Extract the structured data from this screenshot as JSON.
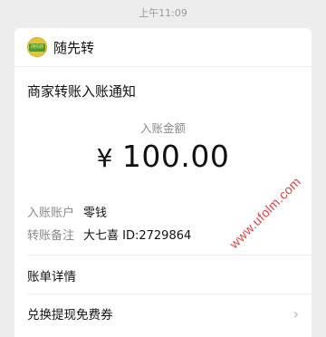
{
  "status_bar": {
    "time": "上午11:09"
  },
  "app": {
    "name": "随先转",
    "logo_icon": "suixianzhuan-logo-icon"
  },
  "notice": {
    "title": "商家转账入账通知",
    "amount_label": "入账金额",
    "currency": "¥",
    "amount": "100.00"
  },
  "details": [
    {
      "label": "入账账户",
      "value": "零钱"
    },
    {
      "label": "转账备注",
      "value": "大七喜 ID:2729864"
    }
  ],
  "links": {
    "bill_details": "账单详情",
    "redeem_coupon": "兑换提现免费券"
  },
  "watermark": "www.ufolm.com"
}
